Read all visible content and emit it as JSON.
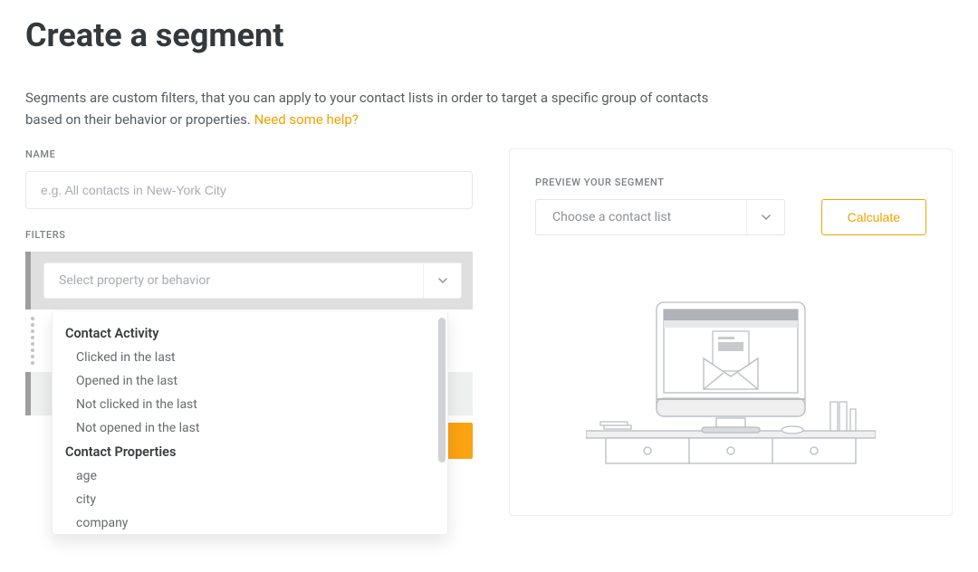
{
  "page": {
    "title": "Create a segment",
    "description": "Segments are custom filters, that you can apply to your contact lists in order to target a specific group of contacts based on their behavior or properties.",
    "help_link": "Need some help?"
  },
  "form": {
    "name_label": "NAME",
    "name_placeholder": "e.g. All contacts in New-York City",
    "filters_label": "FILTERS",
    "property_placeholder": "Select property or behavior"
  },
  "dropdown": {
    "groups": [
      {
        "label": "Contact Activity",
        "options": [
          "Clicked in the last",
          "Opened in the last",
          "Not clicked in the last",
          "Not opened in the last"
        ]
      },
      {
        "label": "Contact Properties",
        "options": [
          "age",
          "city",
          "company"
        ]
      }
    ]
  },
  "preview": {
    "label": "PREVIEW YOUR SEGMENT",
    "contact_list_placeholder": "Choose a contact list",
    "calculate_label": "Calculate"
  },
  "colors": {
    "accent": "#f0a200",
    "cta": "#fca311"
  }
}
